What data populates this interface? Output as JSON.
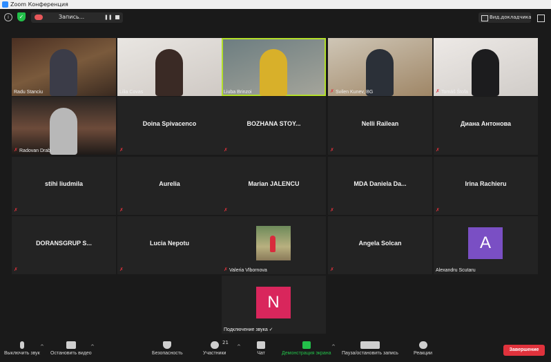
{
  "window": {
    "title": "Zoom Конференция"
  },
  "topbar": {
    "recording_label": "Запись...",
    "view_label": "Вид.докладчика"
  },
  "tiles": [
    {
      "name": "Radu Stanciu",
      "muted": false
    },
    {
      "name": "Lilia Covas",
      "muted": false
    },
    {
      "name": "Liuba Brinzoi",
      "muted": false
    },
    {
      "name": "Svilen Kunev, BG",
      "muted": true
    },
    {
      "name": "Tomáš Štofa",
      "muted": true
    },
    {
      "name": "Radovan Drab",
      "muted": true
    },
    {
      "name": "Doina Spivacenco",
      "muted": true
    },
    {
      "name": "BOZHANA STOY...",
      "muted": true
    },
    {
      "name": "Nelli Railean",
      "muted": true
    },
    {
      "name": "Диана Антонова",
      "muted": true
    },
    {
      "name": "stihi liudmila",
      "muted": true
    },
    {
      "name": "Aurelia",
      "muted": true
    },
    {
      "name": "Marian JALENCU",
      "muted": true
    },
    {
      "name": "MDA Daniela Da...",
      "muted": true
    },
    {
      "name": "Irina Rachieru",
      "muted": true
    },
    {
      "name": "DORANSGRUP S...",
      "muted": true
    },
    {
      "name": "Lucia Nepotu",
      "muted": true
    },
    {
      "name": "Valeria Vlbornova",
      "muted": true
    },
    {
      "name": "Angela Solcan",
      "muted": true
    },
    {
      "name": "Alexandru Scutaru",
      "muted": false,
      "initial": "A",
      "avatar_color": "#7a4fc4"
    },
    {
      "name": "Подключение звука ✓",
      "muted": false,
      "initial": "N",
      "avatar_color": "#d9265c"
    }
  ],
  "toolbar": {
    "mute": "Выключить звук",
    "video": "Остановить видео",
    "security": "Безопасность",
    "participants": "Участники",
    "participants_count": "21",
    "chat": "Чат",
    "share": "Демонстрация экрана",
    "record": "Пауза/остановить запись",
    "reactions": "Реакции",
    "end": "Завершение"
  },
  "colors": {
    "accent_green": "#23c04a",
    "active_border": "#b4e02a",
    "end_red": "#e0323c"
  }
}
